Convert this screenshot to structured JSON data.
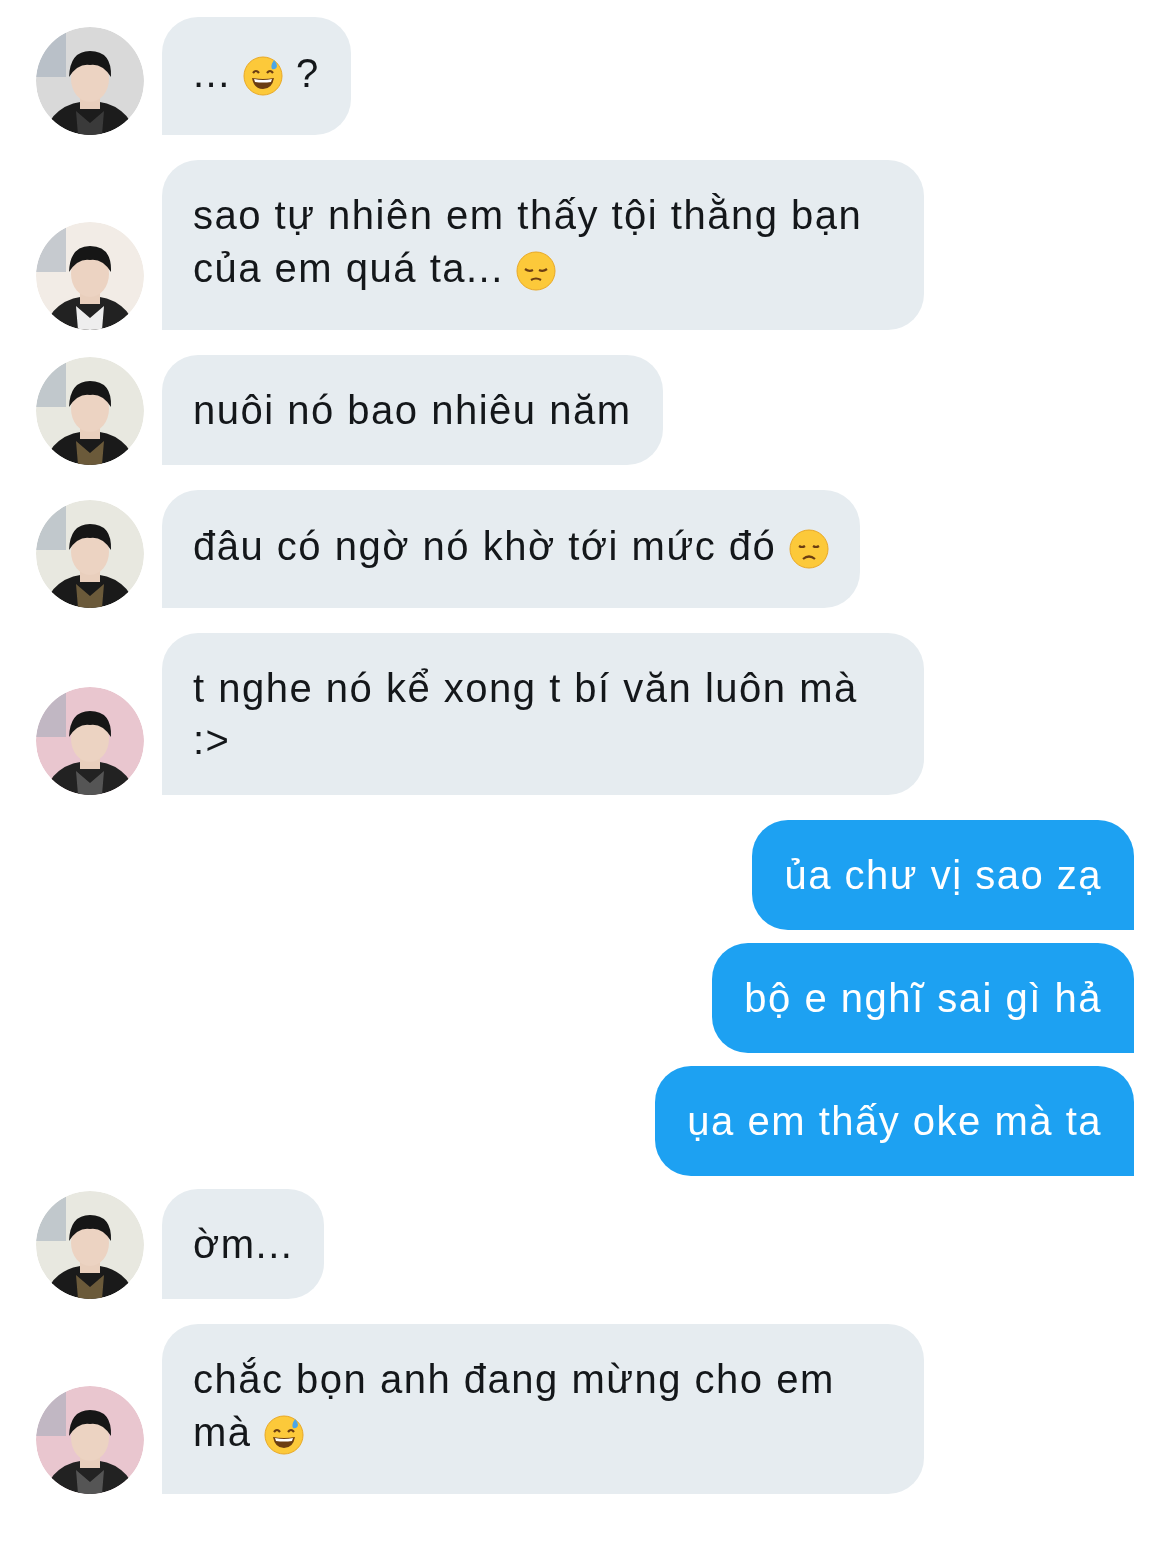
{
  "messages": [
    {
      "kind": "incoming",
      "avatar": {
        "kind": "picture"
      },
      "parts": [
        {
          "kind": "text",
          "text": "... "
        },
        {
          "kind": "sweat-emoji"
        },
        {
          "kind": "text",
          "text": " ?"
        }
      ]
    },
    {
      "kind": "incoming",
      "avatar": {
        "kind": "picture"
      },
      "parts": [
        {
          "kind": "text",
          "text": "sao tự nhiên em thấy tội thằng bạn của em quá ta... "
        },
        {
          "kind": "pensive-emoji"
        }
      ]
    },
    {
      "kind": "incoming",
      "avatar": {
        "kind": "picture"
      },
      "parts": [
        {
          "kind": "text",
          "text": "nuôi nó bao nhiêu năm"
        }
      ]
    },
    {
      "kind": "incoming",
      "avatar": {
        "kind": "picture"
      },
      "parts": [
        {
          "kind": "text",
          "text": "đâu có ngờ nó khờ tới mức đó "
        },
        {
          "kind": "sad-emoji"
        }
      ]
    },
    {
      "kind": "incoming",
      "avatar": {
        "kind": "picture"
      },
      "parts": [
        {
          "kind": "text",
          "text": "t nghe nó kể xong t bí văn luôn mà :>"
        }
      ]
    },
    {
      "kind": "outgoing",
      "parts": [
        {
          "kind": "text",
          "text": "ủa chư vị sao zạ"
        }
      ]
    },
    {
      "kind": "outgoing",
      "parts": [
        {
          "kind": "text",
          "text": "bộ e nghĩ sai gì hả"
        }
      ]
    },
    {
      "kind": "outgoing",
      "parts": [
        {
          "kind": "text",
          "text": "ụa em thấy oke mà ta"
        }
      ]
    },
    {
      "kind": "incoming",
      "avatar": {
        "kind": "picture"
      },
      "parts": [
        {
          "kind": "text",
          "text": "ờm..."
        }
      ]
    },
    {
      "kind": "incoming",
      "avatar": {
        "kind": "picture"
      },
      "parts": [
        {
          "kind": "text",
          "text": "chắc bọn anh đang mừng cho em mà "
        },
        {
          "kind": "sweat-emoji"
        }
      ]
    }
  ]
}
